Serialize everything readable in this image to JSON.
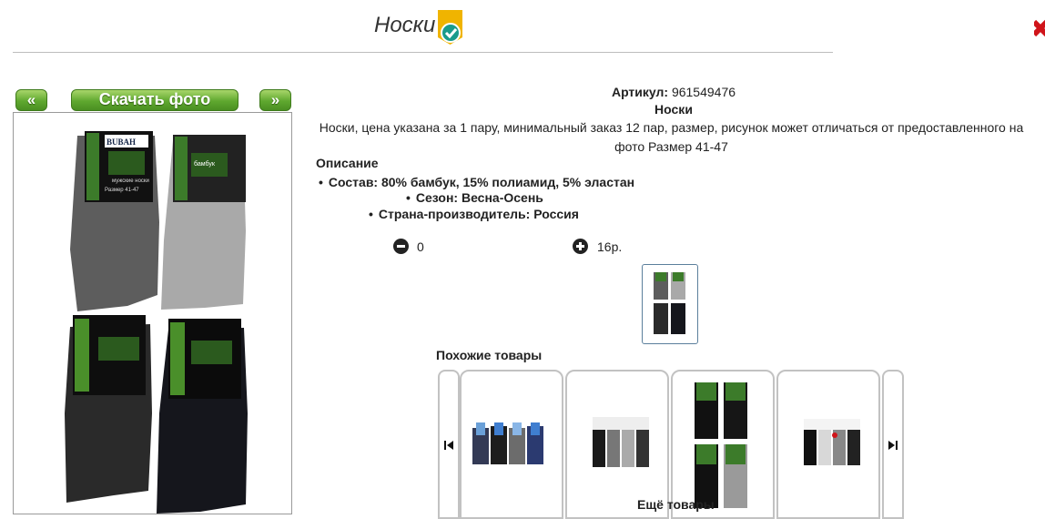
{
  "title": "Носки",
  "nav": {
    "prev": "«",
    "download": "Скачать фото",
    "next": "»"
  },
  "product": {
    "article_label": "Артикул:",
    "article_value": "961549476",
    "name": "Носки",
    "description": "Носки, цена указана за 1 пару, минимальный заказ 12 пар, размер, рисунок может отличаться от предоставленного на фото Размер 41-47",
    "desc_heading": "Описание",
    "properties": [
      "Состав: 80% бамбук, 15% полиамид, 5% эластан",
      "Сезон: Весна-Осень",
      "Страна-производитель: Россия"
    ]
  },
  "quantity": {
    "value": "0",
    "price": "16р."
  },
  "package": {
    "brand": "BUBAH",
    "label_line1": "мужские носки",
    "label_line2": "Размер 41-47",
    "tag": "бамбук"
  },
  "similar": {
    "heading": "Похожие товары",
    "more_label": "Ещё товары"
  },
  "colors": {
    "accent_green": "#5fa82f",
    "badge_yellow": "#f0b400",
    "badge_teal": "#1a9b8c"
  }
}
